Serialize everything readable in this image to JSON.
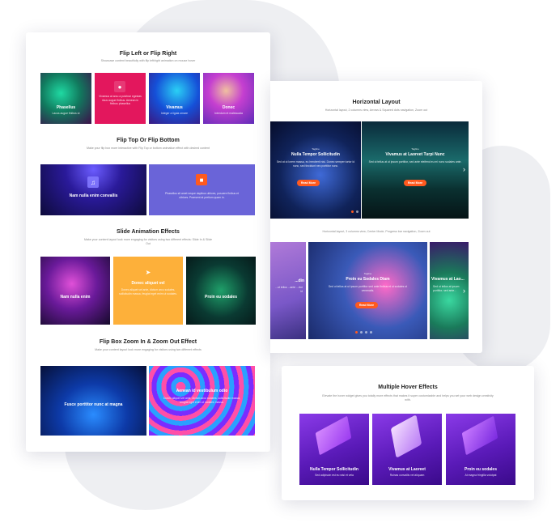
{
  "left_panel": {
    "flip_lr": {
      "title": "Flip Left or Flip Right",
      "subtitle": "Showcase content beautifully with flip left/right animation on mouse hover",
      "tiles": [
        {
          "caption": "Phasellus",
          "text": "Lacus augue finibus ut"
        },
        {
          "caption": "",
          "text": "Vivamus at arcu a pulvinar egestas risus augue finibus. Aenean in finibus phasellus"
        },
        {
          "caption": "Vivamus",
          "text": "Integer a ligula ornare"
        },
        {
          "caption": "Donec",
          "text": "Interdum et malesuada"
        }
      ]
    },
    "flip_tb": {
      "title": "Flip Top Or Flip Bottom",
      "subtitle": "Make your flip box more interactive with Flip Top or bottom animation effect with desired content",
      "tiles": [
        {
          "caption": "Nam nulla enim convallis",
          "text": ""
        },
        {
          "caption": "",
          "text": "Phasellus sit amet neque dapibus ultrices, posuere finibus et ultrices. Praesent at pretium quam in."
        }
      ]
    },
    "slide": {
      "title": "Slide Animation Effects",
      "subtitle": "Make your content layout look more engaging for visitors using two different effects: Slide In & Slide Out",
      "tiles": [
        {
          "caption": "Nam nulla enim",
          "text": ""
        },
        {
          "caption": "Donec aliquet vel",
          "text": "Donec aliquet vel ante, dictum arcu sodales, sollicitudin massa, feugiat eget enim ut sodales."
        },
        {
          "caption": "Proin eu sodales",
          "text": ""
        }
      ]
    },
    "zoom": {
      "title": "Flip Box Zoom In & Zoom Out Effect",
      "subtitle": "Make your content layout look more engaging for visitors using two different effects",
      "tiles": [
        {
          "caption": "Fusce porttitor nunc at magna",
          "text": ""
        },
        {
          "caption": "Aenean id vestibulum odio",
          "text": "Donec aliquet vel ante, dictum arcu sodales, sollicitudin massa, feugiat eget enim ut sodales massa."
        }
      ]
    }
  },
  "right_top": {
    "title": "Horizontal Layout",
    "subtitle": "Horizontal layout, 2 columns view, Arrows & Squared dots navigation, Zoom out",
    "slides": [
      {
        "heading": "Nulla Tempor Sollicitudin",
        "body": "Sed at ut lorem massa, eu hendrerit nisi. Donec semper tortor id nunc, sed tincidunt nec porttitor nunc.",
        "button": "Read More",
        "label": "Tagline"
      },
      {
        "heading": "Vivamus at Laoreet Turpi Nunc",
        "body": "Sed ut tellus at ut ipsum porttitor, sed ante eleifend eu mi nunc sodales ante.",
        "button": "Read More",
        "label": "Tagline"
      }
    ],
    "subtitle2": "Horizontal layout, 3 columns view, Center Mode, Progress bar navigation, Zoom out",
    "slides2": [
      {
        "heading": "...din",
        "body": "...ut tellus ...ante ...rtor id"
      },
      {
        "heading": "Proin eu Sodales Diam",
        "body": "Sed ut tellus at ut ipsum porttitor sed ante finibus et ut sodales ut venenatis.",
        "button": "Read More",
        "label": "Tagline"
      },
      {
        "heading": "Vivamus at Lao...",
        "body": "Sed ut tellus at ipsum porttitor, sed ante..."
      }
    ]
  },
  "right_bottom": {
    "title": "Multiple Hover Effects",
    "subtitle": "Elevate the hover widget gives you totally more effects that makes it super customizable and helps you set your web design creativity with.",
    "items": [
      {
        "caption": "Nulla Tempor Sollicitudin",
        "text": "Sed adipiscin est eu wisi et vela"
      },
      {
        "caption": "Vivamus at Laoreet",
        "text": "Ruinas convallis vel aliquam"
      },
      {
        "caption": "Proin eu sodales",
        "text": "At magna fringilla volutpat"
      }
    ]
  }
}
